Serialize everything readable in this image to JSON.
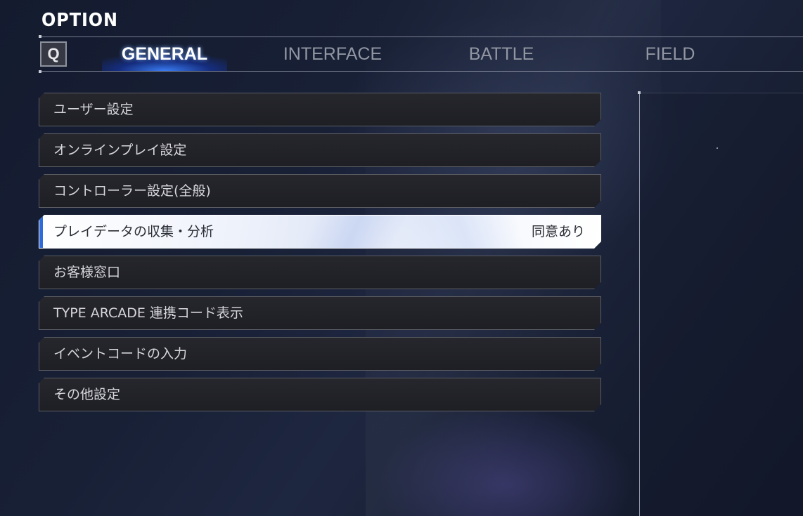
{
  "page_title": "OPTION",
  "tab_bar": {
    "prev_key_label": "Q",
    "tabs": [
      {
        "label": "GENERAL",
        "active": true
      },
      {
        "label": "INTERFACE",
        "active": false
      },
      {
        "label": "BATTLE",
        "active": false
      },
      {
        "label": "FIELD",
        "active": false
      }
    ]
  },
  "menu": {
    "items": [
      {
        "label": "ユーザー設定",
        "value": ""
      },
      {
        "label": "オンラインプレイ設定",
        "value": ""
      },
      {
        "label": "コントローラー設定(全般)",
        "value": ""
      },
      {
        "label": "プレイデータの収集・分析",
        "value": "同意あり",
        "selected": true
      },
      {
        "label": "お客様窓口",
        "value": ""
      },
      {
        "label": "TYPE ARCADE 連携コード表示",
        "value": ""
      },
      {
        "label": "イベントコードの入力",
        "value": ""
      },
      {
        "label": "その他設定",
        "value": ""
      }
    ]
  },
  "colors": {
    "accent": "#2f6bd8",
    "selected_bg": "#eef2fb",
    "item_bg": "#222328",
    "background": "#182036"
  }
}
